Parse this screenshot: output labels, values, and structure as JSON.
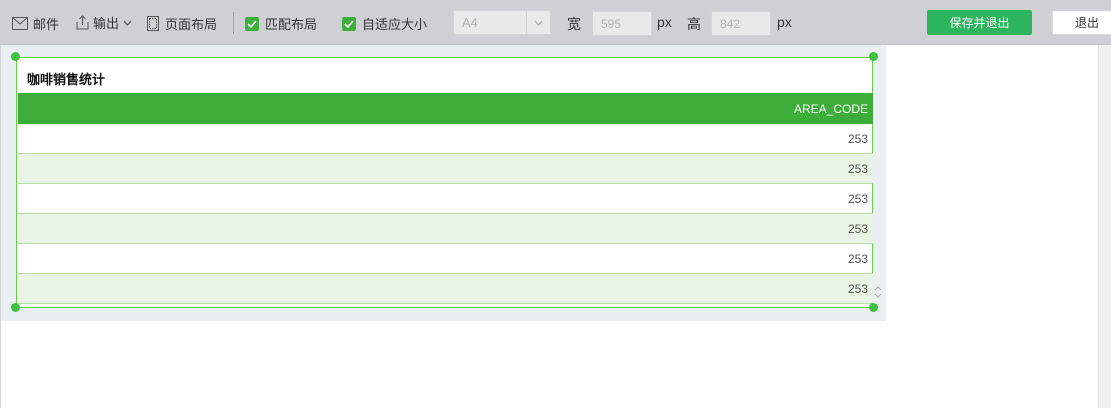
{
  "toolbar": {
    "mail": {
      "label": "邮件",
      "icon": "mail-icon"
    },
    "export": {
      "label": "输出",
      "icon": "export-icon"
    },
    "page_layout": {
      "label": "页面布局",
      "icon": "page-layout-icon"
    },
    "match_layout": {
      "label": "匹配布局",
      "checked": true
    },
    "auto_fit": {
      "label": "自适应大小",
      "checked": true
    },
    "paper_size": {
      "value": "A4"
    },
    "width": {
      "label": "宽",
      "value": "595",
      "unit": "px"
    },
    "height": {
      "label": "高",
      "value": "842",
      "unit": "px"
    },
    "save_exit_label": "保存并退出",
    "exit_label": "退出"
  },
  "report": {
    "title": "咖啡销售统计",
    "column_header": "AREA_CODE",
    "rows": [
      "253",
      "253",
      "253",
      "253",
      "253",
      "253"
    ]
  },
  "colors": {
    "header_green": "#3cad39",
    "alt_row": "#e8f5e4",
    "save_button": "#2db55d",
    "selection": "#66cc44"
  }
}
